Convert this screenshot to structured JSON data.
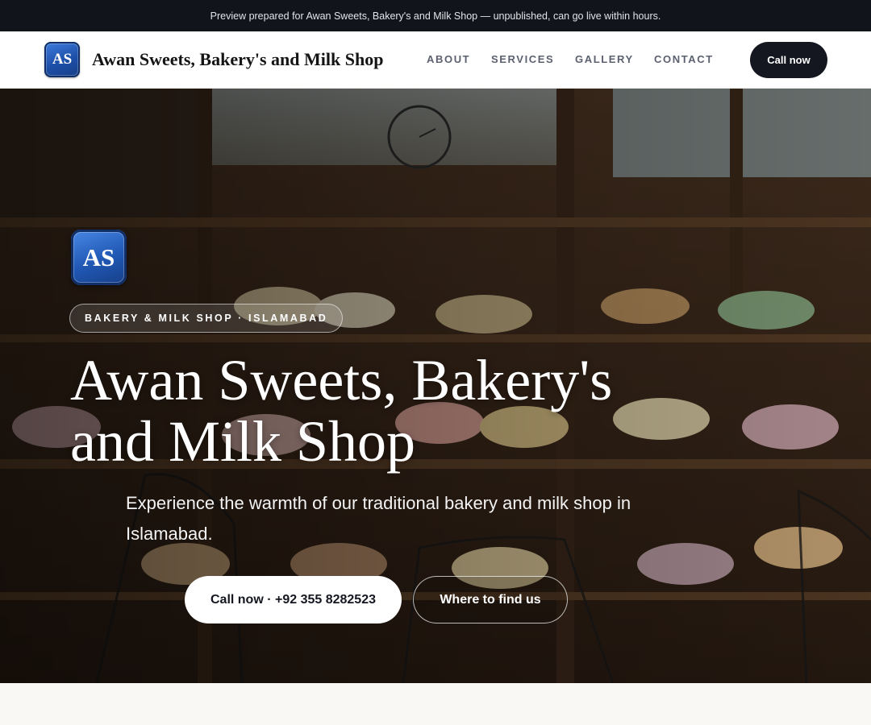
{
  "notice": {
    "text": "Preview prepared for Awan Sweets, Bakery's and Milk Shop — unpublished, can go live within hours."
  },
  "header": {
    "logo_text": "AS",
    "brand_name": "Awan Sweets, Bakery's and Milk Shop",
    "nav": [
      {
        "label": "ABOUT"
      },
      {
        "label": "SERVICES"
      },
      {
        "label": "GALLERY"
      },
      {
        "label": "CONTACT"
      }
    ],
    "call_label": "Call now"
  },
  "hero": {
    "logo_text": "AS",
    "tag": "BAKERY & MILK SHOP · ISLAMABAD",
    "title_line1": "Awan Sweets, Bakery's",
    "title_line2": "and Milk Shop",
    "subtitle": "Experience the warmth of our traditional bakery and milk shop in Islamabad.",
    "primary_cta": "Call now · +92 355 8282523",
    "secondary_cta": "Where to find us"
  },
  "colors": {
    "notice_bg": "#11141a",
    "brand_blue": "#1d4fa8",
    "dark_button": "#141720",
    "page_bg": "#f9f8f5"
  }
}
